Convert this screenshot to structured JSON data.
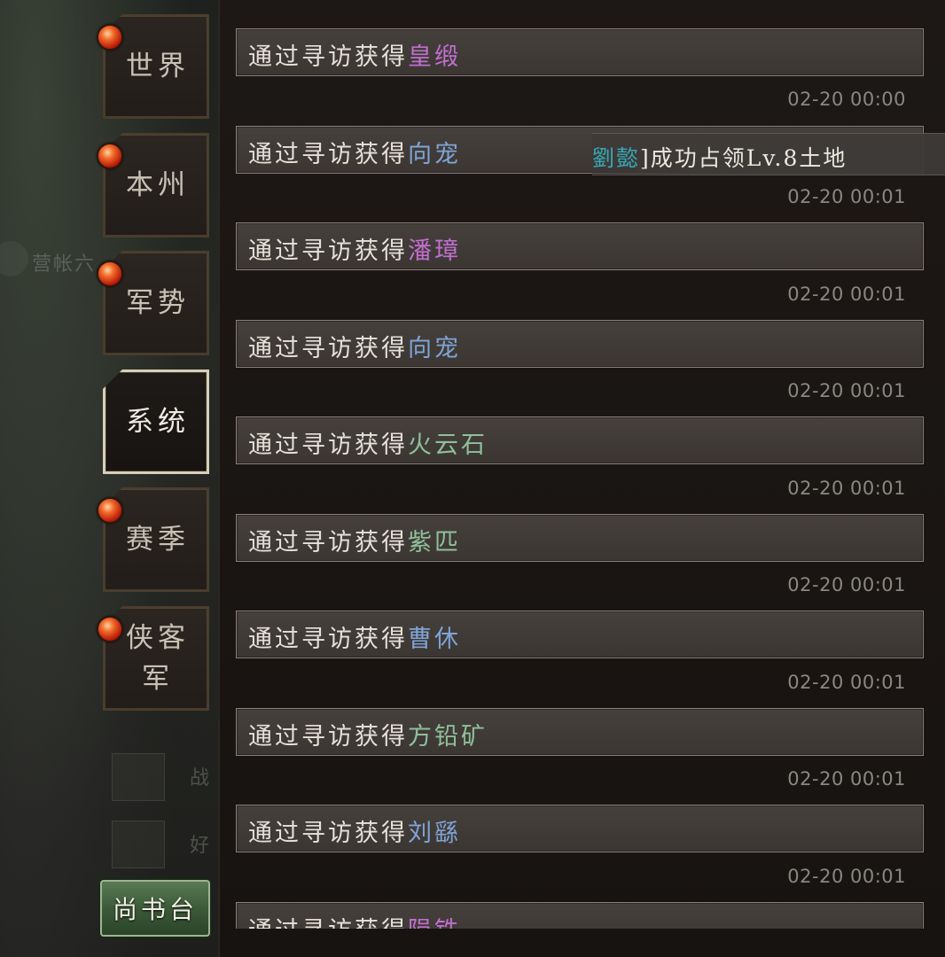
{
  "colors": {
    "item_purple": "#c16fcf",
    "item_blue": "#7fa4d6",
    "item_green": "#8fc09a",
    "player_cyan": "#36a9b6",
    "badge_red": "#d8361a",
    "button_green": "#3c5a38"
  },
  "sidebar": {
    "tabs": [
      {
        "label": "世界",
        "badge": true,
        "active": false
      },
      {
        "label": "本州",
        "badge": true,
        "active": false
      },
      {
        "label": "军势",
        "badge": true,
        "active": false
      },
      {
        "label": "系统",
        "badge": false,
        "active": true
      },
      {
        "label": "赛季",
        "badge": true,
        "active": false
      },
      {
        "label": "侠客\n军",
        "badge": true,
        "active": false
      }
    ],
    "shangshu_button": "尚书台"
  },
  "map_background": {
    "camp_label": "营帐六",
    "battle_label": "战",
    "friend_label": "好"
  },
  "notification": {
    "player": "劉㦤",
    "text": "]成功占领Lv.8土地"
  },
  "messages": [
    {
      "prefix": "通过寻访获得",
      "item": "皇缎",
      "item_color": "#c16fcf",
      "time": "02-20 00:00"
    },
    {
      "prefix": "通过寻访获得",
      "item": "向宠",
      "item_color": "#7fa4d6",
      "time": "02-20 00:01"
    },
    {
      "prefix": "通过寻访获得",
      "item": "潘璋",
      "item_color": "#c16fcf",
      "time": "02-20 00:01"
    },
    {
      "prefix": "通过寻访获得",
      "item": "向宠",
      "item_color": "#7fa4d6",
      "time": "02-20 00:01"
    },
    {
      "prefix": "通过寻访获得",
      "item": "火云石",
      "item_color": "#8fc09a",
      "time": "02-20 00:01"
    },
    {
      "prefix": "通过寻访获得",
      "item": "紫匹",
      "item_color": "#8fc09a",
      "time": "02-20 00:01"
    },
    {
      "prefix": "通过寻访获得",
      "item": "曹休",
      "item_color": "#7fa4d6",
      "time": "02-20 00:01"
    },
    {
      "prefix": "通过寻访获得",
      "item": "方铅矿",
      "item_color": "#8fc09a",
      "time": "02-20 00:01"
    },
    {
      "prefix": "通过寻访获得",
      "item": "刘繇",
      "item_color": "#7fa4d6",
      "time": "02-20 00:01"
    },
    {
      "prefix": "通过寻访获得",
      "item": "陨铁",
      "item_color": "#c16fcf",
      "time": ""
    }
  ]
}
